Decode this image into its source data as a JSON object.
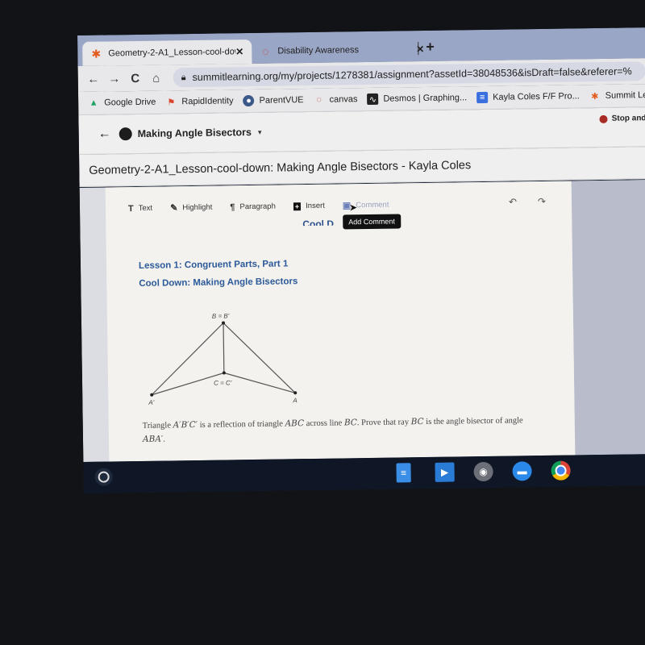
{
  "browser": {
    "tabs": [
      {
        "title": "Geometry-2-A1_Lesson-cool-dow",
        "icon": "summit-asterisk-icon",
        "active": true
      },
      {
        "title": "Disability Awareness",
        "icon": "canvas-ring-icon",
        "active": false
      }
    ],
    "close_glyph": "✕",
    "new_tab_glyph": "+",
    "nav": {
      "back": "←",
      "forward": "→",
      "reload": "C",
      "home": "⌂"
    },
    "url": "summitlearning.org/my/projects/1278381/assignment?assetId=38048536&isDraft=false&referer=%",
    "bookmarks": [
      {
        "label": "Google Drive",
        "icon": "google-drive-icon"
      },
      {
        "label": "RapidIdentity",
        "icon": "rapididentity-icon"
      },
      {
        "label": "ParentVUE",
        "icon": "parentvue-icon"
      },
      {
        "label": "canvas",
        "icon": "canvas-icon"
      },
      {
        "label": "Desmos | Graphing...",
        "icon": "desmos-icon"
      },
      {
        "label": "Kayla Coles F/F Pro...",
        "icon": "google-docs-icon"
      },
      {
        "label": "Summit Le",
        "icon": "summit-icon"
      }
    ]
  },
  "app": {
    "back_glyph": "←",
    "project_title": "Making Angle Bisectors",
    "caret": "▾",
    "stop_label": "Stop and",
    "doc_title": "Geometry-2-A1_Lesson-cool-down: Making Angle Bisectors - Kayla Coles"
  },
  "editor": {
    "tools": [
      {
        "label": "Text",
        "glyph": "T"
      },
      {
        "label": "Highlight",
        "glyph": "✎"
      },
      {
        "label": "Paragraph",
        "glyph": "¶"
      },
      {
        "label": "Insert",
        "glyph": "+"
      },
      {
        "label": "Comment",
        "glyph": "▣"
      }
    ],
    "undo_glyph": "↶",
    "redo_glyph": "↷",
    "tooltip": "Add Comment",
    "partial_heading": "Cool D"
  },
  "document": {
    "lesson": "Lesson 1: Congruent Parts, Part 1",
    "cooldown": "Cool Down: Making Angle Bisectors",
    "diagram_labels": {
      "top": "B = B'",
      "middle": "C = C'",
      "left": "A'",
      "right": "A"
    },
    "problem_parts": [
      "Triangle ",
      "A′B′C′",
      " is a reflection of triangle ",
      "ABC",
      " across line ",
      "BC",
      ". Prove that ray ",
      "BC",
      " is the angle bisector of angle ",
      "ABA′",
      "."
    ]
  },
  "shelf": {
    "apps": [
      "google-docs-icon",
      "play-store-icon",
      "camera-icon",
      "files-icon",
      "chrome-icon"
    ]
  }
}
